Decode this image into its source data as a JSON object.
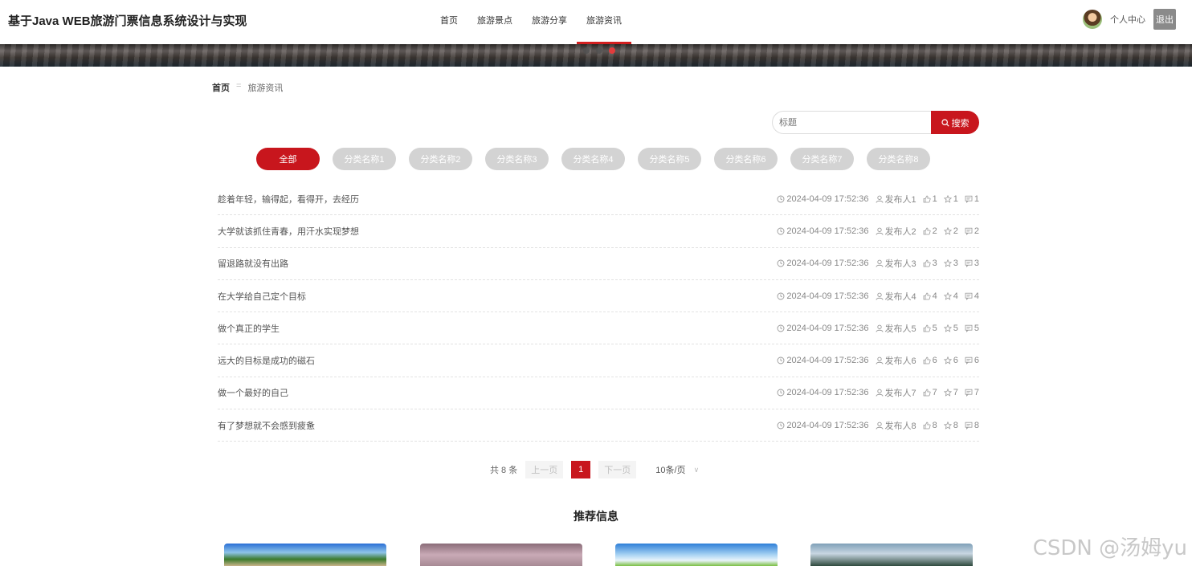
{
  "header": {
    "site_title": "基于Java WEB旅游门票信息系统设计与实现",
    "nav": [
      {
        "label": "首页"
      },
      {
        "label": "旅游景点"
      },
      {
        "label": "旅游分享"
      },
      {
        "label": "旅游资讯",
        "active": true
      }
    ],
    "user_center": "个人中心",
    "logout": "退出"
  },
  "banner": {
    "active_dot": 3,
    "dot_count": 3
  },
  "breadcrumb": {
    "home": "首页",
    "separator": "=",
    "current": "旅游资讯"
  },
  "search": {
    "placeholder": "标题",
    "button_label": "搜索"
  },
  "categories": [
    "全部",
    "分类名称1",
    "分类名称2",
    "分类名称3",
    "分类名称4",
    "分类名称5",
    "分类名称6",
    "分类名称7",
    "分类名称8"
  ],
  "news": [
    {
      "title": "趁着年轻，输得起，看得开，去经历",
      "time": "2024-04-09 17:52:36",
      "author": "发布人1",
      "likes": "1",
      "favs": "1",
      "comments": "1"
    },
    {
      "title": "大学就该抓住青春，用汗水实现梦想",
      "time": "2024-04-09 17:52:36",
      "author": "发布人2",
      "likes": "2",
      "favs": "2",
      "comments": "2"
    },
    {
      "title": "留退路就没有出路",
      "time": "2024-04-09 17:52:36",
      "author": "发布人3",
      "likes": "3",
      "favs": "3",
      "comments": "3"
    },
    {
      "title": "在大学给自己定个目标",
      "time": "2024-04-09 17:52:36",
      "author": "发布人4",
      "likes": "4",
      "favs": "4",
      "comments": "4"
    },
    {
      "title": "做个真正的学生",
      "time": "2024-04-09 17:52:36",
      "author": "发布人5",
      "likes": "5",
      "favs": "5",
      "comments": "5"
    },
    {
      "title": "远大的目标是成功的磁石",
      "time": "2024-04-09 17:52:36",
      "author": "发布人6",
      "likes": "6",
      "favs": "6",
      "comments": "6"
    },
    {
      "title": "做一个最好的自己",
      "time": "2024-04-09 17:52:36",
      "author": "发布人7",
      "likes": "7",
      "favs": "7",
      "comments": "7"
    },
    {
      "title": "有了梦想就不会感到疲惫",
      "time": "2024-04-09 17:52:36",
      "author": "发布人8",
      "likes": "8",
      "favs": "8",
      "comments": "8"
    }
  ],
  "pagination": {
    "total": "共 8 条",
    "prev": "上一页",
    "page": "1",
    "next": "下一页",
    "page_size": "10条/页"
  },
  "recommend": {
    "title": "推荐信息"
  },
  "watermark": "CSDN @汤姆yu",
  "colors": {
    "accent": "#c8161d",
    "pill_inactive": "#d3d3d3"
  }
}
